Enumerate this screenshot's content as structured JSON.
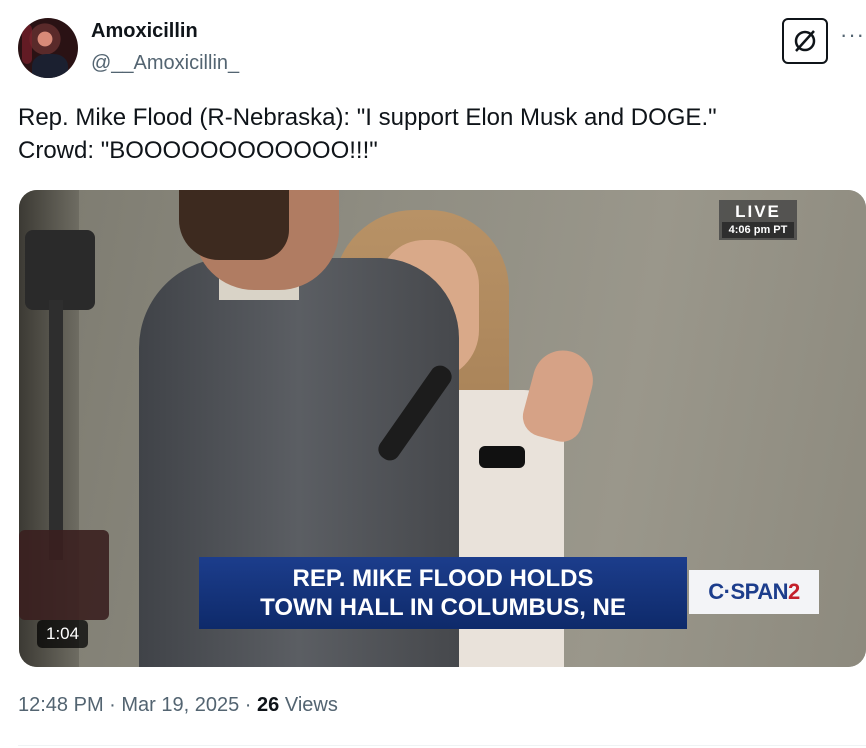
{
  "author": {
    "display_name": "Amoxicillin",
    "handle": "@__Amoxicillin_"
  },
  "tweet": {
    "lines": [
      "Rep. Mike Flood (R-Nebraska): \"I support Elon Musk and DOGE.\"",
      "Crowd: \"BOOOOOOOOOOOO!!!\""
    ]
  },
  "video": {
    "live_label": "LIVE",
    "live_time": "4:06 pm PT",
    "chyron_line1": "REP. MIKE FLOOD HOLDS",
    "chyron_line2": "TOWN HALL IN COLUMBUS, NE",
    "network_prefix": "C·SPAN",
    "network_suffix": "2",
    "duration": "1:04"
  },
  "meta": {
    "time": "12:48 PM",
    "sep1": " · ",
    "date": "Mar 19, 2025",
    "sep2": " · ",
    "views_count": "26",
    "views_label": " Views"
  },
  "icons": {
    "grok": "grok-icon",
    "more": "more-icon"
  }
}
